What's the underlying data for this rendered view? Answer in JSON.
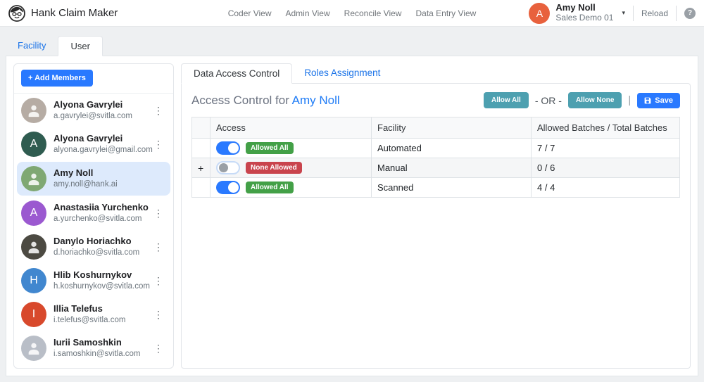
{
  "app": {
    "title": "Hank Claim Maker"
  },
  "icons": {
    "kebab": "⋮",
    "caret": "▾",
    "help": "?"
  },
  "header": {
    "nav_links": [
      {
        "label": "Coder View"
      },
      {
        "label": "Admin View"
      },
      {
        "label": "Reconcile View"
      },
      {
        "label": "Data Entry View"
      }
    ],
    "user_menu": {
      "avatar_initial": "A",
      "avatar_color": "#e8613d",
      "name": "Amy Noll",
      "org": "Sales Demo 01"
    },
    "reload_label": "Reload"
  },
  "main_tabs": {
    "facility": "Facility",
    "user": "User"
  },
  "sidebar": {
    "add_members_label": "+ Add Members",
    "members": [
      {
        "name": "Alyona Gavrylei",
        "email": "a.gavrylei@svitla.com",
        "avatar": "photo",
        "avatar_color": "#b6aca4"
      },
      {
        "name": "Alyona Gavrylei",
        "email": "alyona.gavrylei@gmail.com",
        "avatar": "letter",
        "initial": "A",
        "avatar_color": "#2f5c50"
      },
      {
        "name": "Amy Noll",
        "email": "amy.noll@hank.ai",
        "avatar": "photo",
        "avatar_color": "#7fa873",
        "selected": true
      },
      {
        "name": "Anastasiia Yurchenko",
        "email": "a.yurchenko@svitla.com",
        "avatar": "letter",
        "initial": "A",
        "avatar_color": "#9b59d0"
      },
      {
        "name": "Danylo Horiachko",
        "email": "d.horiachko@svitla.com",
        "avatar": "photo",
        "avatar_color": "#4c4a42"
      },
      {
        "name": "Hlib Koshurnykov",
        "email": "h.koshurnykov@svitla.com",
        "avatar": "letter",
        "initial": "H",
        "avatar_color": "#4187cf"
      },
      {
        "name": "Illia Telefus",
        "email": "i.telefus@svitla.com",
        "avatar": "letter",
        "initial": "I",
        "avatar_color": "#d8492c"
      },
      {
        "name": "Iurii Samoshkin",
        "email": "i.samoshkin@svitla.com",
        "avatar": "photo",
        "avatar_color": "#b9bec7"
      }
    ]
  },
  "panel": {
    "tabs": {
      "data_access": "Data Access Control",
      "roles": "Roles Assignment"
    },
    "heading": {
      "prefix": "Access Control for ",
      "name": "Amy Noll"
    },
    "toolbar": {
      "allow_all": "Allow All",
      "or": "- OR -",
      "allow_none": "Allow None",
      "separator": "|",
      "save": "Save"
    },
    "table": {
      "columns": {
        "expander": "",
        "access": "Access",
        "facility": "Facility",
        "batches": "Allowed Batches / Total Batches"
      },
      "rows": [
        {
          "expander": "",
          "toggle": "on",
          "badge": "Allowed All",
          "badge_color": "#43a047",
          "facility": "Automated",
          "batches": "7 / 7"
        },
        {
          "expander": "+",
          "toggle": "off",
          "badge": "None Allowed",
          "badge_color": "#c9444d",
          "facility": "Manual",
          "batches": "0 / 6"
        },
        {
          "expander": "",
          "toggle": "on",
          "badge": "Allowed All",
          "badge_color": "#43a047",
          "facility": "Scanned",
          "batches": "4 / 4"
        }
      ]
    }
  },
  "colors": {
    "accent_blue": "#2979ff",
    "teal": "#4da0b0",
    "link_blue": "#1a73e8",
    "selected_member_bg": "#ddeafc"
  }
}
